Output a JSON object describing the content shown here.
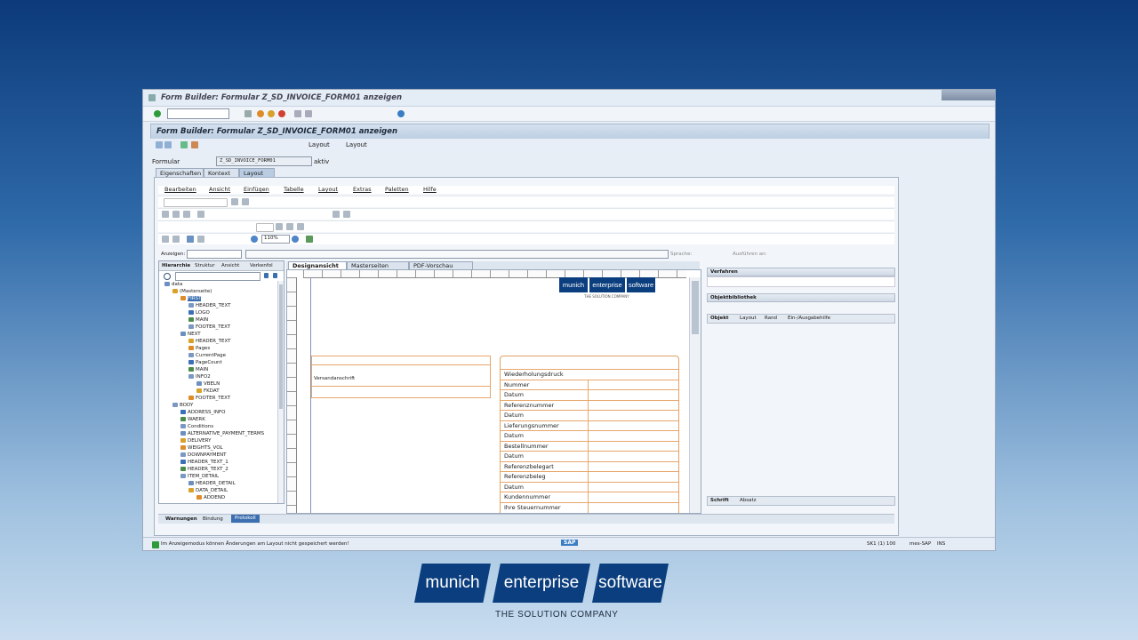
{
  "window": {
    "title": "Form Builder: Formular Z_SD_INVOICE_FORM01 anzeigen",
    "header": "Form Builder: Formular Z_SD_INVOICE_FORM01 anzeigen",
    "layout_btn1": "Layout",
    "layout_btn2": "Layout"
  },
  "form_field": {
    "label": "Formular",
    "value": "Z_SD_INVOICE_FORM01",
    "status": "aktiv"
  },
  "tabs": [
    "Eigenschaften",
    "Kontext",
    "Layout"
  ],
  "menu": [
    "Bearbeiten",
    "Ansicht",
    "Einfügen",
    "Tabelle",
    "Layout",
    "Extras",
    "Paletten",
    "Hilfe"
  ],
  "zoom": "110%",
  "anzeigen_label": "Anzeigen:",
  "sprache_label": "Sprache:",
  "ausfuehren_label": "Ausführen an:",
  "hierarchy_tabs": [
    "Hierarchie",
    "Struktur",
    "Ansicht",
    "Verkenfol"
  ],
  "tree": [
    "data",
    "(Masterseite)",
    "FIRST",
    "HEADER_TEXT",
    "LOGO",
    "MAIN",
    "FOOTER_TEXT",
    "NEXT",
    "HEADER_TEXT",
    "Pages",
    "CurrentPage",
    "PageCount",
    "MAIN",
    "INFO2",
    "VBELN",
    "FKDAT",
    "FOOTER_TEXT",
    "BODY",
    "ADDRESS_INFO",
    "WAERK",
    "Conditions",
    "ALTERNATIVE_PAYMENT_TERMS",
    "DELIVERY",
    "WEIGHTS_VOL",
    "DOWNPAYMENT",
    "HEADER_TEXT_1",
    "HEADER_TEXT_2",
    "ITEM_DETAIL",
    "HEADER_DETAIL",
    "DATA_DETAIL",
    "ADDEND"
  ],
  "design_tabs": [
    "Designansicht",
    "Masterseiten",
    "PDF-Vorschau"
  ],
  "canvas": {
    "versand": "Versandanschrift",
    "rows": [
      "Wiederholungsdruck",
      "Nummer",
      "Datum",
      "Referenznummer",
      "Datum",
      "Lieferungsnummer",
      "Datum",
      "Bestellnummer",
      "Datum",
      "Referenzbelegart",
      "Referenzbeleg",
      "Datum",
      "Kundennummer",
      "Ihre Steuernummer"
    ]
  },
  "right_panels": {
    "verfahren": "Verfahren",
    "objektbibliothek": "Objektbibliothek",
    "objekt_tabs": [
      "Objekt",
      "Layout",
      "Rand",
      "Ein-/Ausgabehilfe"
    ],
    "schrift_tabs": [
      "Schrift",
      "Absatz"
    ]
  },
  "bottom_tabs": [
    "Warnungen",
    "Bindung",
    "Protokoll"
  ],
  "status": {
    "message": "Im Anzeigemodus können Änderungen am Layout nicht gespeichert werden!",
    "system": "SK1 (1) 100",
    "server": "mes-SAP",
    "mode": "INS",
    "sap": "SAP"
  },
  "brand": {
    "w1": "munich",
    "w2": "enterprise",
    "w3": "software",
    "tagline": "THE SOLUTION COMPANY"
  }
}
